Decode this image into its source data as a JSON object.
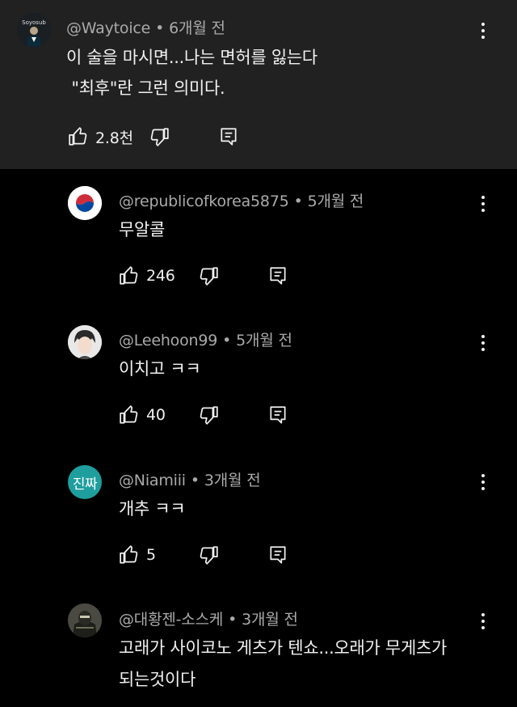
{
  "comments": [
    {
      "handle": "@Waytoice",
      "time": "6개월 전",
      "lines": [
        "이 술을 마시면...나는 면허를 잃는다",
        " \"최후\"란 그런 의미다."
      ],
      "likes": "2.8천",
      "avatar_text": "Soyosub",
      "avatar_color": "#1a1f24"
    },
    {
      "handle": "@republicofkorea5875",
      "time": "5개월 전",
      "lines": [
        "무알콜"
      ],
      "likes": "246",
      "avatar_color": "#ffffff"
    },
    {
      "handle": "@Leehoon99",
      "time": "5개월 전",
      "lines": [
        "이치고 ㅋㅋ"
      ],
      "likes": "40",
      "avatar_color": "#dcdcdc"
    },
    {
      "handle": "@Niamiii",
      "time": "3개월 전",
      "lines": [
        "개추 ㅋㅋ"
      ],
      "likes": "5",
      "avatar_text": "진짜",
      "avatar_color": "#1f9e9e"
    },
    {
      "handle": "@대황젠-소스케",
      "time": "3개월 전",
      "lines": [
        "고래가 사이코노 게츠가 텐쇼...오래가 무게츠가",
        "되는것이다"
      ],
      "avatar_color": "#3a3a34"
    }
  ],
  "separator": "•",
  "colors": {
    "top_bg": "#212121",
    "page_bg": "#000000",
    "text": "#f1f1f1",
    "meta": "#aaaaaa"
  }
}
